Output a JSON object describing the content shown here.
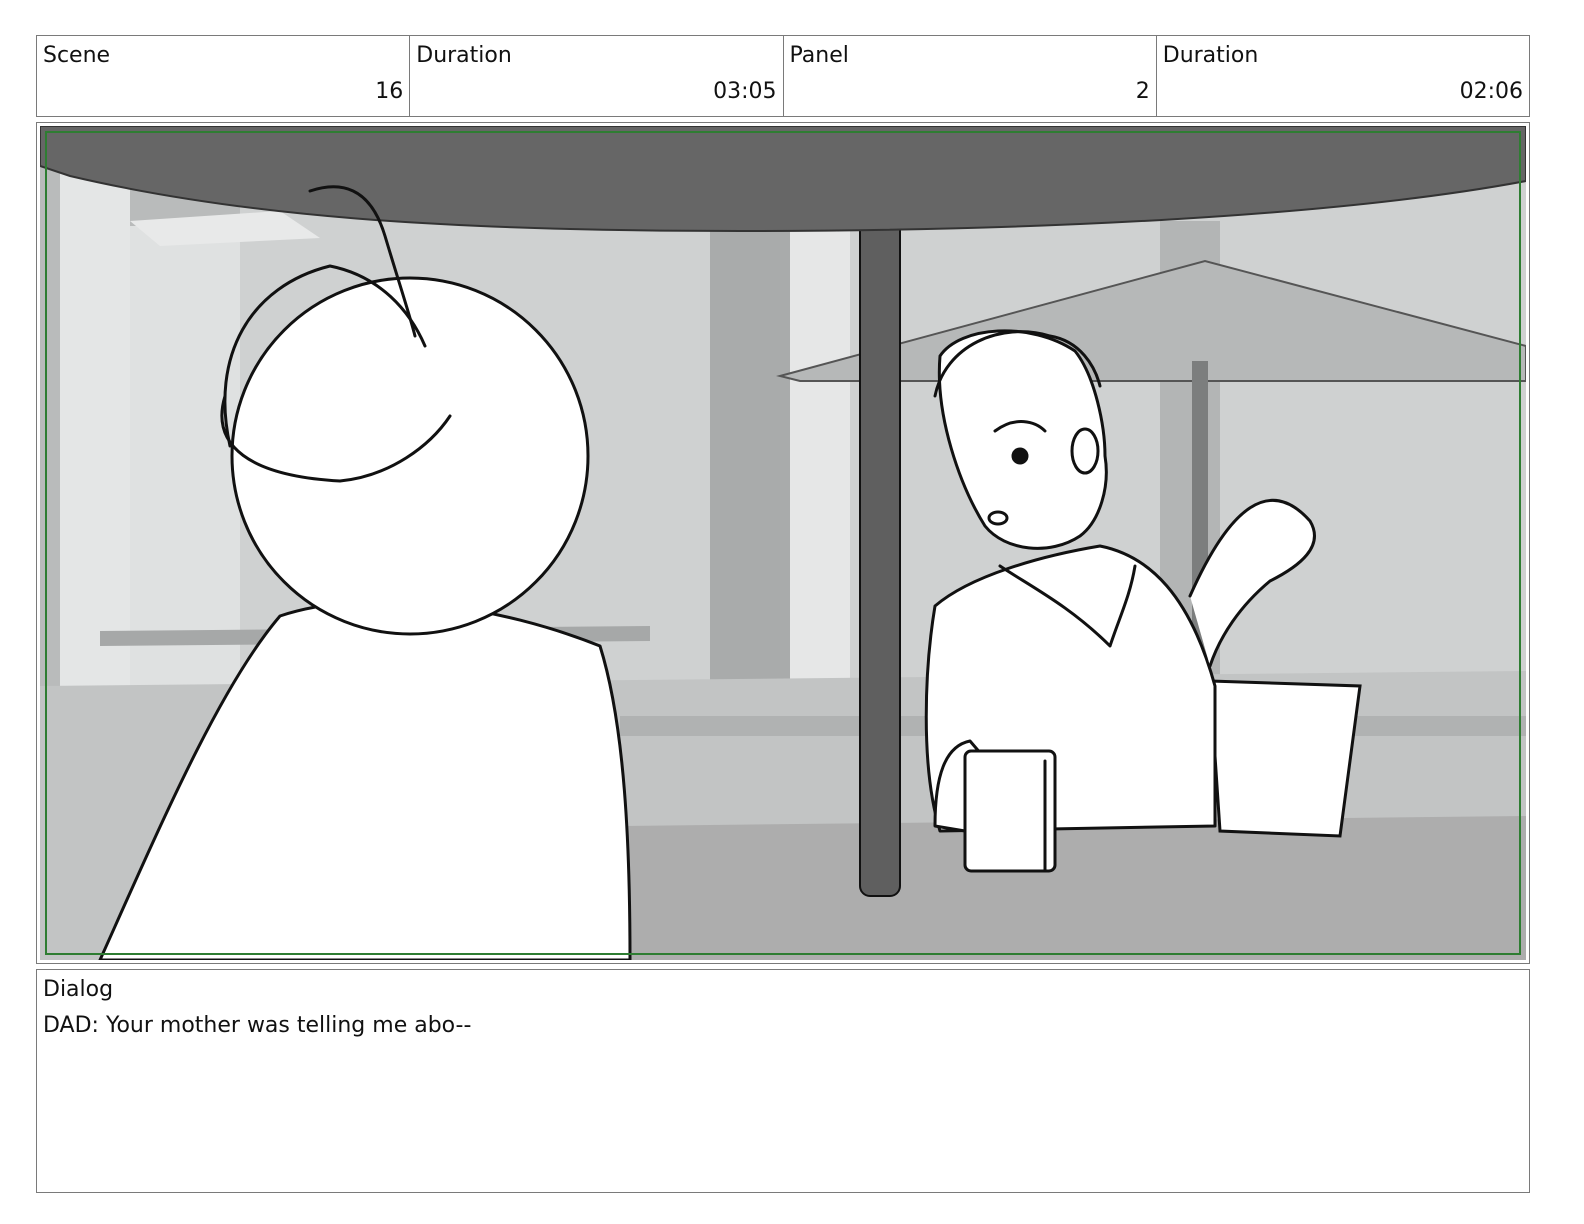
{
  "header": {
    "cells": [
      {
        "label": "Scene",
        "value": "16"
      },
      {
        "label": "Duration",
        "value": "03:05"
      },
      {
        "label": "Panel",
        "value": "2"
      },
      {
        "label": "Duration",
        "value": "02:06"
      }
    ]
  },
  "dialog": {
    "label": "Dialog",
    "text": "DAD: Your mother was telling me abo--"
  },
  "colors": {
    "frame_border": "#7a7a7a",
    "safe_area": "#2e7d32",
    "umbrella": "#666666",
    "background_wall": "#cfd1d1",
    "table": "#adadad"
  }
}
